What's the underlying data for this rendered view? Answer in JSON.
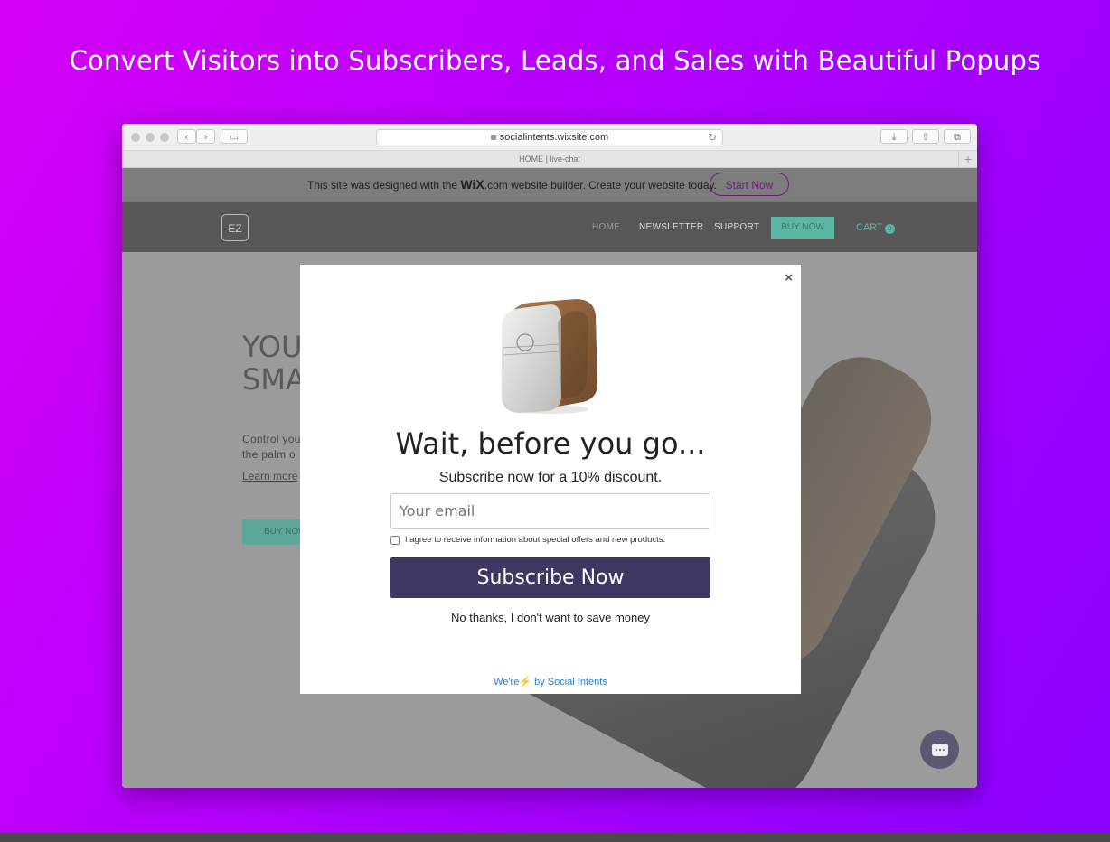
{
  "headline": "Convert Visitors into Subscribers, Leads, and Sales with Beautiful Popups",
  "browser": {
    "url": "socialintents.wixsite.com",
    "tab_title": "HOME | live-chat",
    "back_icon": "‹",
    "forward_icon": "›",
    "sidebar_icon": "▭",
    "download_icon": "⤓",
    "share_icon": "⇧",
    "tabs_icon": "⧉",
    "reload_icon": "↻",
    "new_tab_icon": "+"
  },
  "wix_banner": {
    "text_before": "This site was designed with the ",
    "brand": "WiX",
    "text_after": ".com website builder. Create your website today.",
    "button_label": "Start Now"
  },
  "site_nav": {
    "logo": "EZ",
    "items": [
      "HOME",
      "NEWSLETTER",
      "SUPPORT"
    ],
    "buy_label": "BUY NOW",
    "cart_label": "CART",
    "cart_count": "0"
  },
  "hero": {
    "title_line1": "YOU",
    "title_line2": "SMA",
    "text_line1": "Control you",
    "text_line2": "the palm o",
    "learn_more": "Learn more",
    "buy_label": "BUY NOW"
  },
  "popup": {
    "title": "Wait, before you go...",
    "subtitle": "Subscribe now for a 10% discount.",
    "email_placeholder": "Your email",
    "email_value": "",
    "agree_text": "I agree to receive information about special offers and new products.",
    "subscribe_label": "Subscribe Now",
    "decline_label": "No thanks, I don't want to save money",
    "powered_before": "We're",
    "powered_bolt": "⚡",
    "powered_after": " by Social Intents",
    "close_icon": "×"
  },
  "colors": {
    "subscribe_button": "#3f3761",
    "accent_teal": "#5bb6a4",
    "powered_link": "#2a7fd4"
  }
}
